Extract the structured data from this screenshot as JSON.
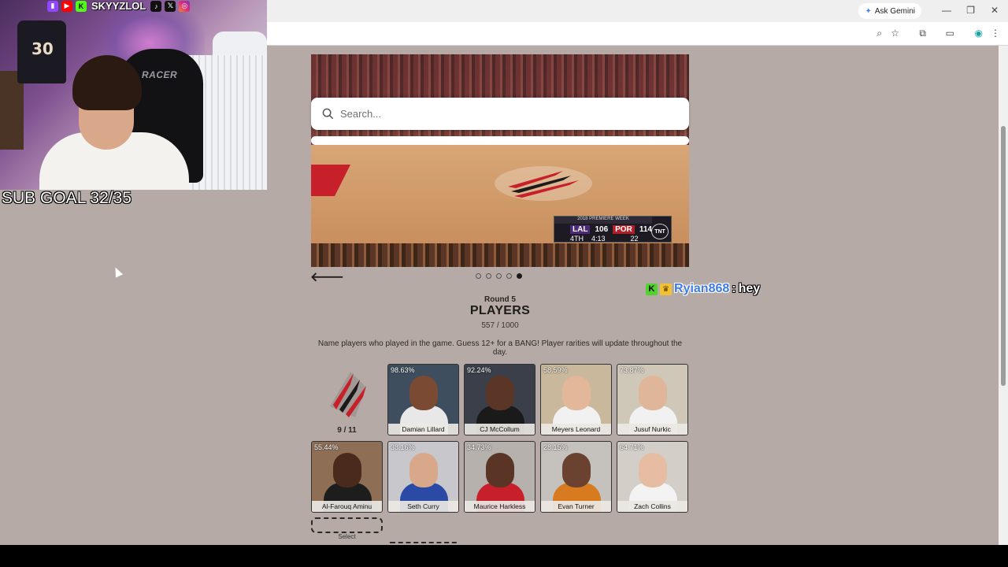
{
  "stream_overlay": {
    "social_handle": "SKYYZLOL",
    "jersey_number": "30",
    "chair_brand": "RACER",
    "sub_goal": "SUB GOAL 32/35"
  },
  "browser": {
    "ask_gemini_label": "Ask Gemini"
  },
  "search": {
    "placeholder": "Search..."
  },
  "hero": {
    "scorebug": {
      "event": "2018 PREMIERE WEEK",
      "away_team": "LAL",
      "away_score": "106",
      "home_team": "POR",
      "home_score": "114",
      "period": "4TH",
      "clock": "4:13",
      "shot_clock": "22",
      "network": "TNT"
    }
  },
  "carousel": {
    "total": 5,
    "active_index": 4
  },
  "game": {
    "round_label": "Round 5",
    "section_title": "PLAYERS",
    "score": "557 / 1000",
    "instructions": "Name players who played in the game. Guess 12+ for a BANG! Player rarities will update throughout the day.",
    "team_count": "9 / 11",
    "select_label": "Select"
  },
  "players": [
    {
      "pct": "98.63%",
      "name": "Damian Lillard"
    },
    {
      "pct": "92.24%",
      "name": "CJ McCollum"
    },
    {
      "pct": "58.59%",
      "name": "Meyers Leonard"
    },
    {
      "pct": "73.87%",
      "name": "Jusuf Nurkic"
    },
    {
      "pct": "55.44%",
      "name": "Al-Farouq Aminu"
    },
    {
      "pct": "38.16%",
      "name": "Seth Curry"
    },
    {
      "pct": "34.73%",
      "name": "Maurice Harkless"
    },
    {
      "pct": "28.15%",
      "name": "Evan Turner"
    },
    {
      "pct": "64.71%",
      "name": "Zach Collins"
    }
  ],
  "chat": {
    "user": "Ryian868",
    "separator": ":",
    "message": "hey"
  },
  "colors": {
    "page_bg": "#b5aaa6",
    "blazers_red": "#c8202a",
    "lakers_purple": "#4e2a7a",
    "chat_user": "#3d7be0"
  }
}
